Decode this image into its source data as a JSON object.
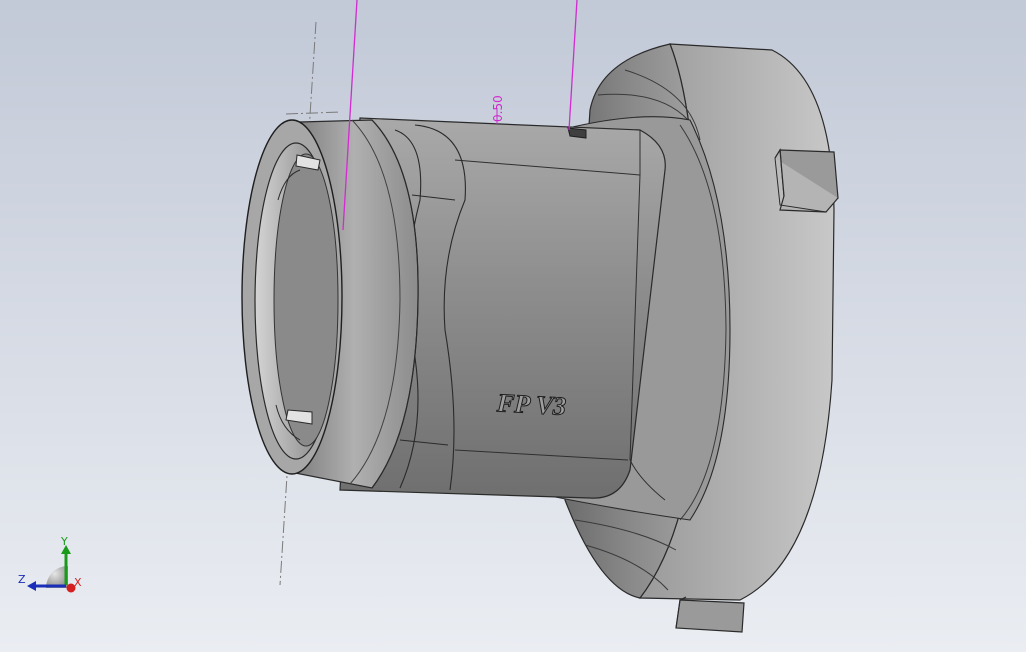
{
  "model": {
    "engraved_text": "FP V3",
    "dimension_text": "0.50"
  },
  "triad": {
    "x_label": "X",
    "y_label": "Y",
    "z_label": "Z"
  },
  "colors": {
    "background_top": "#c4cbd8",
    "background_bottom": "#e8ebf0",
    "part_light": "#b9b9b9",
    "part_mid": "#8f8f8f",
    "part_dark": "#5a5a5a",
    "edge": "#2a2a2a",
    "dimension": "#d12bd1",
    "axis_x": "#d42020",
    "axis_y": "#1a9a1a",
    "axis_z": "#1a2eb8"
  }
}
